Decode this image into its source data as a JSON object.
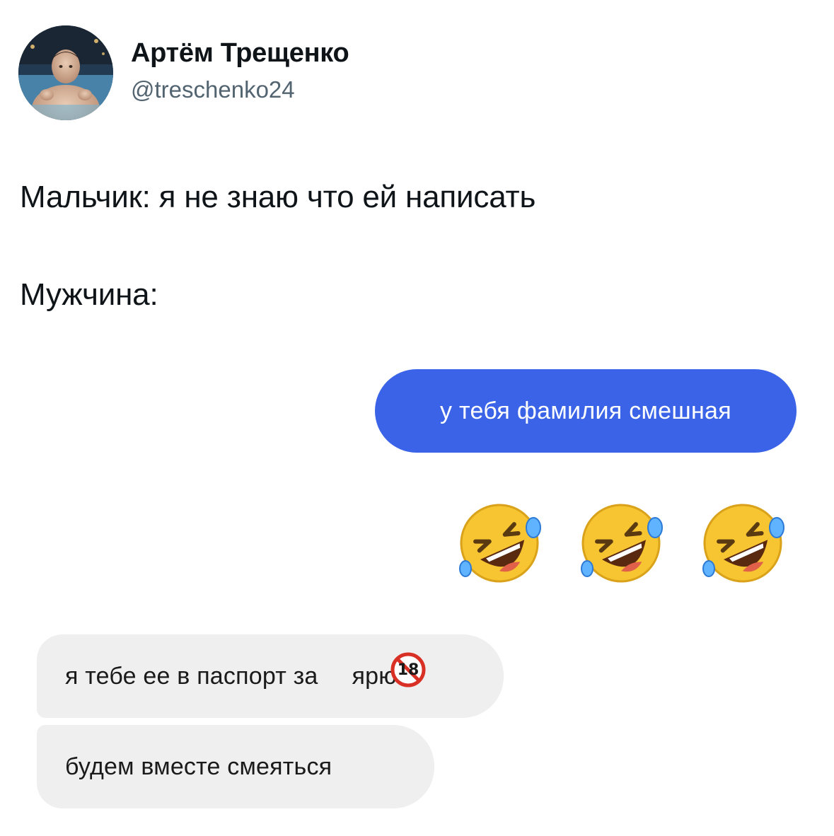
{
  "tweet": {
    "author": {
      "name": "Артём Трещенко",
      "handle": "@treschenko24",
      "avatar_icon": "profile-photo"
    },
    "lines": [
      "Мальчик: я не знаю что ей написать",
      "Мужчина:"
    ]
  },
  "chat": {
    "sent_message": "у тебя фамилия смешная",
    "sent_bubble_color": "#3a63e8",
    "reaction_emoji": [
      "🤣",
      "🤣",
      "🤣"
    ],
    "reaction_icon": "rolling-on-floor-laughing-icon",
    "received_messages": [
      {
        "before": "я тебе ее в паспорт за",
        "after": "ярю"
      },
      {
        "text": "будем вместе смеяться"
      }
    ],
    "received_bubble_color": "#efefef",
    "censor_badge": {
      "label": "18",
      "icon": "no-under-18-icon",
      "color": "#d93025"
    }
  }
}
